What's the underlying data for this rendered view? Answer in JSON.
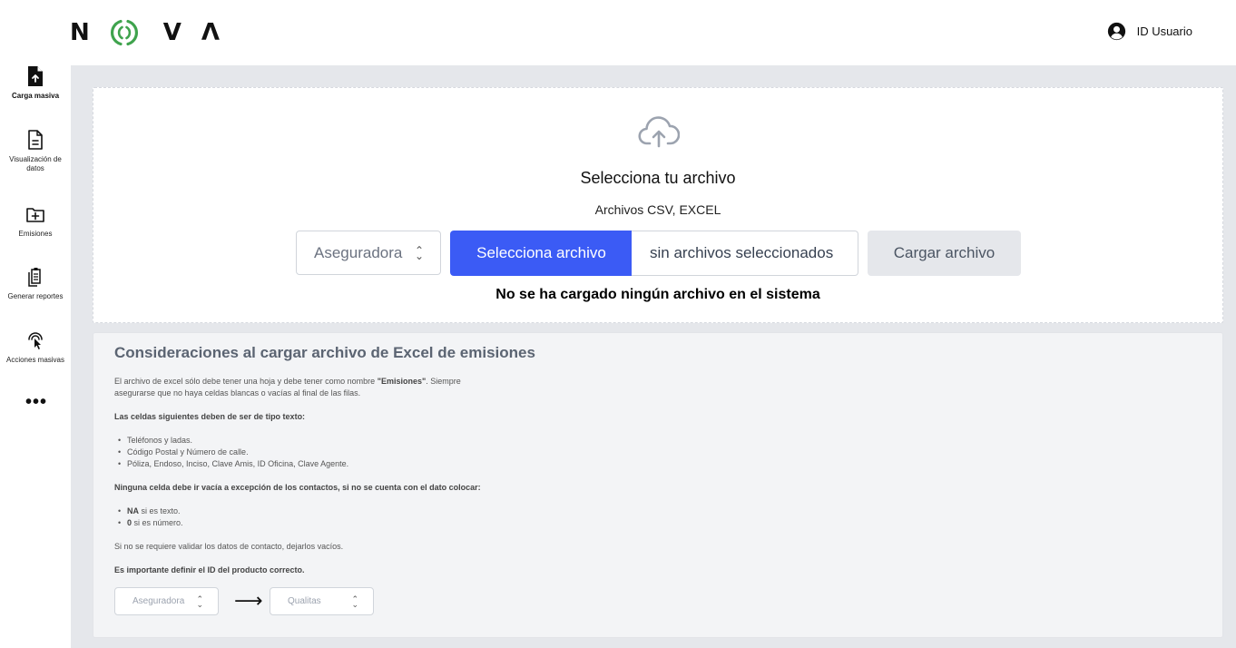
{
  "header": {
    "logo_letters": [
      "N",
      "V",
      "Λ"
    ],
    "user_label": "ID Usuario"
  },
  "sidebar": {
    "items": [
      {
        "label": "Carga masiva",
        "icon": "file-upload-icon",
        "active": true
      },
      {
        "label": "Visualización de datos",
        "icon": "document-icon",
        "active": false
      },
      {
        "label": "Emisiones",
        "icon": "folder-plus-icon",
        "active": false
      },
      {
        "label": "Generar reportes",
        "icon": "clipboard-copy-icon",
        "active": false
      },
      {
        "label": "Acciones masivas",
        "icon": "tap-pointer-icon",
        "active": false
      }
    ],
    "more": "•••"
  },
  "upload": {
    "title": "Selecciona tu archivo",
    "subtitle": "Archivos CSV, EXCEL",
    "insurer_select": "Aseguradora",
    "choose_file_button": "Selecciona archivo",
    "no_file_text": "sin archivos seleccionados",
    "load_button": "Cargar archivo",
    "status": "No se ha cargado ningún archivo en el sistema"
  },
  "info": {
    "title": "Consideraciones al cargar archivo de Excel de emisiones",
    "p1_start": "El archivo de excel sólo debe tener una hoja y debe tener como nombre ",
    "p1_bold": "\"Emisiones\"",
    "p1_end": ". Siempre asegurarse que no haya celdas blancas o vacías al final de las filas.",
    "text_cells_heading": "Las celdas siguientes deben de ser de tipo texto:",
    "text_cells": [
      "Teléfonos y ladas.",
      "Código Postal y Número de calle.",
      "Póliza, Endoso, Inciso, Clave Amis, ID Oficina, Clave Agente."
    ],
    "empty_heading": "Ninguna celda debe ir vacía a excepción de los contactos, si no se cuenta con el dato colocar:",
    "empty_items": [
      {
        "bold": "NA",
        "text": " si es texto."
      },
      {
        "bold": "0",
        "text": " si es número."
      }
    ],
    "contact_note": "Si no se requiere validar los datos de contacto, dejarlos vacíos.",
    "id_note": "Es importante definir el ID del producto correcto.",
    "map_from": "Aseguradora",
    "map_arrow": "⟶",
    "map_to": "Qualitas"
  },
  "colors": {
    "primary": "#3b5bf5",
    "logo_green": "#3fa34d",
    "background": "#e5e7eb"
  }
}
